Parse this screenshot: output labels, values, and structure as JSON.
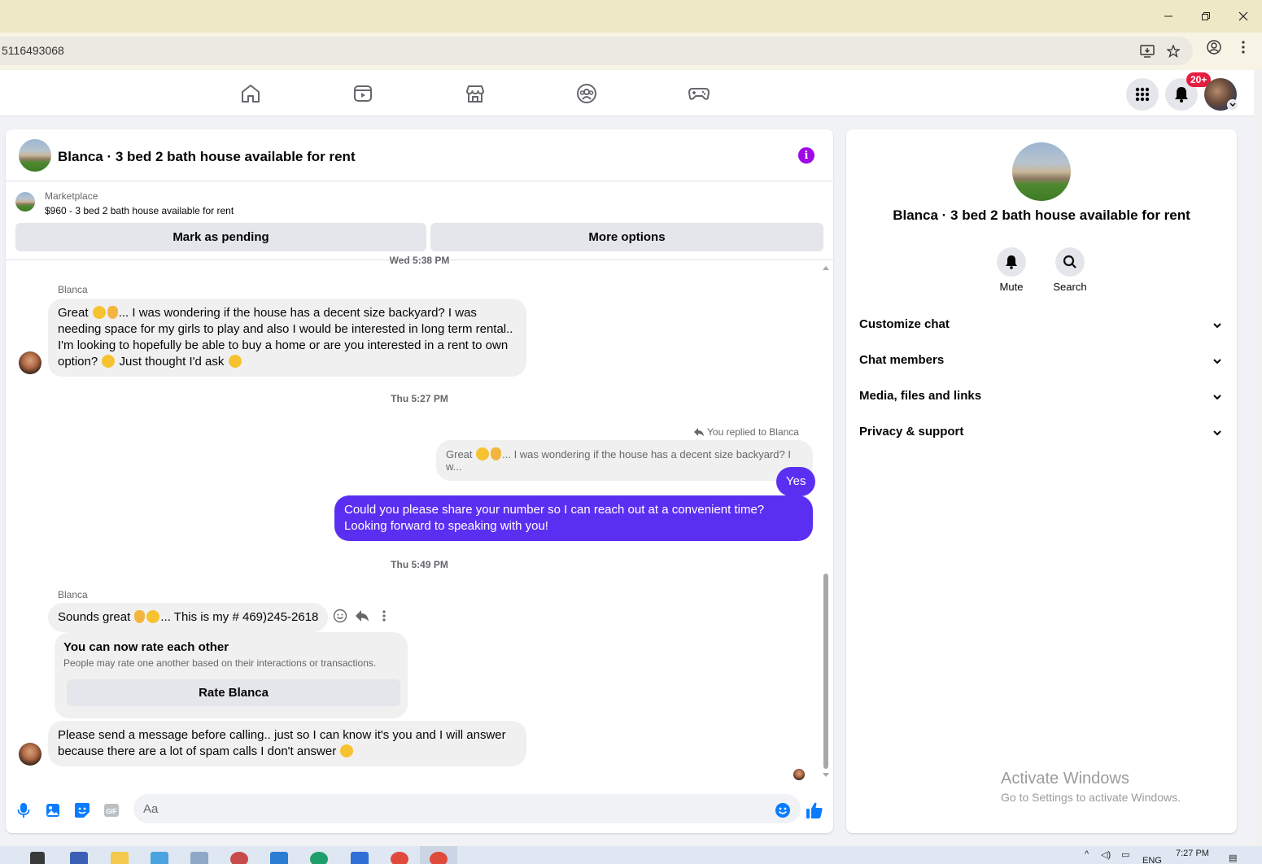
{
  "window": {
    "minimize_icon": "minimize-icon",
    "restore_icon": "restore-icon",
    "close_icon": "close-icon"
  },
  "browser": {
    "url": "5116493068"
  },
  "fbnav": {
    "notification_badge": "20+"
  },
  "chat": {
    "title": "Blanca · 3 bed 2 bath house available for rent",
    "marketplace_label": "Marketplace",
    "listing": "$960 - 3 bed 2 bath house available for rent",
    "mark_pending_label": "Mark as pending",
    "more_options_label": "More options",
    "top_partial_timestamp": "Wed 5:38 PM",
    "messages": {
      "m1_sender": "Blanca",
      "m1_text_a": "Great ",
      "m1_text_b": "... I was wondering if the house has a decent size backyard? I was needing space for my girls to play and also I would be interested in long term rental.. I'm looking to hopefully be able to buy a home or are you interested in a rent to own option? ",
      "m1_text_c": " Just thought I'd ask ",
      "ts2": "Thu 5:27 PM",
      "reply_note": "You replied to Blanca",
      "quote_a": "Great ",
      "quote_b": "... I was wondering if the house has a decent size backyard? I w...",
      "yes": "Yes",
      "out_msg": "Could you please share your number so I can reach out at a convenient time? Looking forward to speaking with you!",
      "ts3": "Thu 5:49 PM",
      "m2_sender": "Blanca",
      "m2_text_a": "Sounds great ",
      "m2_text_b": "... This is my # 469)245-2618",
      "rate_title": "You can now rate each other",
      "rate_desc": "People may rate one another based on their interactions or transactions.",
      "rate_button": "Rate Blanca",
      "m3_text_a": "Please send a message before calling.. just so I can know it's you and I will answer because there are a lot of spam calls I don't answer ",
      "m3_text_b": ""
    },
    "composer_placeholder": "Aa"
  },
  "info": {
    "title": "Blanca · 3 bed 2 bath house available for rent",
    "mute_label": "Mute",
    "search_label": "Search",
    "rows": [
      "Customize chat",
      "Chat members",
      "Media, files and links",
      "Privacy & support"
    ]
  },
  "watermark": {
    "line1": "Activate Windows",
    "line2": "Go to Settings to activate Windows."
  },
  "taskbar": {
    "lang": "ENG",
    "time": "7:27 PM"
  },
  "colors": {
    "accent": "#5b2ff2",
    "info_purple": "#a008e8",
    "messenger_blue": "#0a7cff",
    "badge_red": "#e41e3f"
  }
}
